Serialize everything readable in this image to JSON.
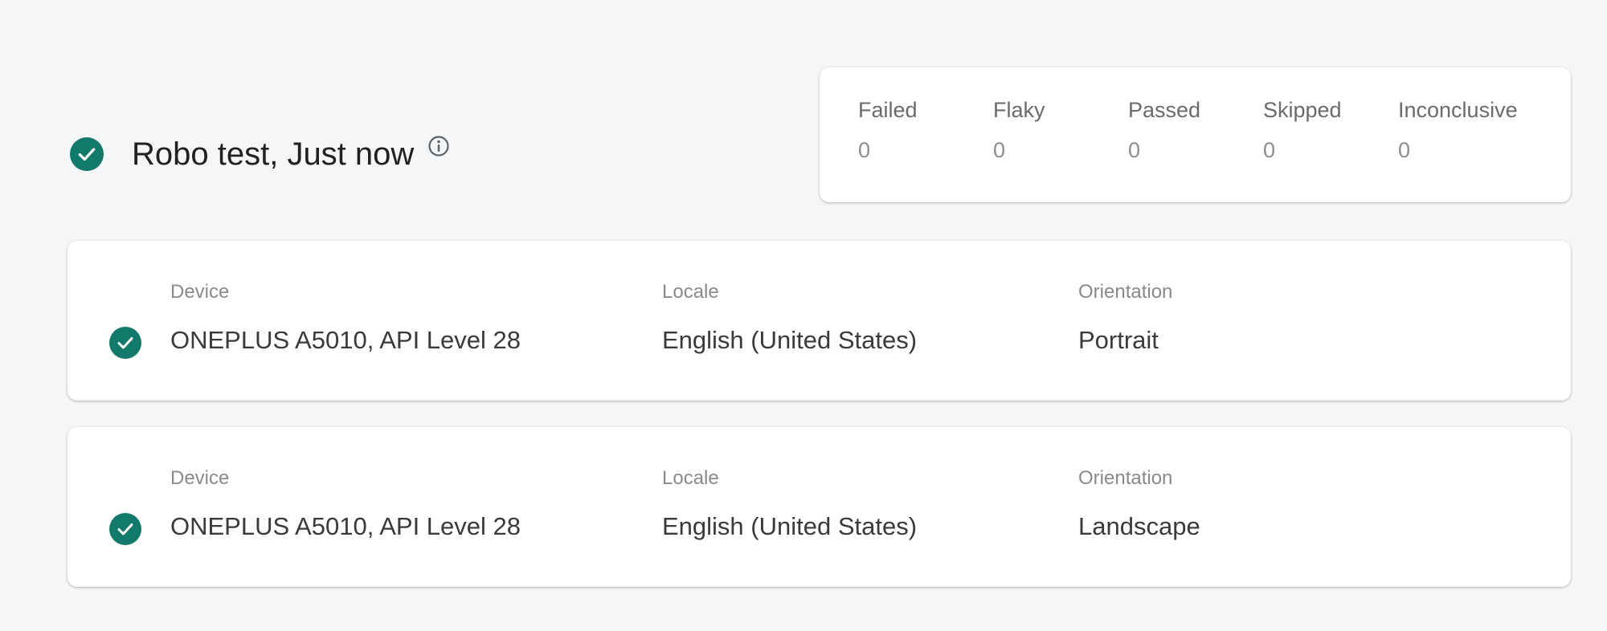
{
  "header": {
    "title": "Robo test, Just now",
    "status_icon": "check-circle-icon",
    "info_icon": "info-icon"
  },
  "summary": {
    "stats": [
      {
        "label": "Failed",
        "value": "0"
      },
      {
        "label": "Flaky",
        "value": "0"
      },
      {
        "label": "Passed",
        "value": "0"
      },
      {
        "label": "Skipped",
        "value": "0"
      },
      {
        "label": "Inconclusive",
        "value": "0"
      }
    ]
  },
  "runs": [
    {
      "status_icon": "check-circle-icon",
      "device_label": "Device",
      "device": "ONEPLUS A5010, API Level 28",
      "locale_label": "Locale",
      "locale": "English (United States)",
      "orientation_label": "Orientation",
      "orientation": "Portrait"
    },
    {
      "status_icon": "check-circle-icon",
      "device_label": "Device",
      "device": "ONEPLUS A5010, API Level 28",
      "locale_label": "Locale",
      "locale": "English (United States)",
      "orientation_label": "Orientation",
      "orientation": "Landscape"
    }
  ],
  "colors": {
    "success": "#127a6b",
    "background": "#f5f6f8",
    "card": "#ffffff"
  }
}
